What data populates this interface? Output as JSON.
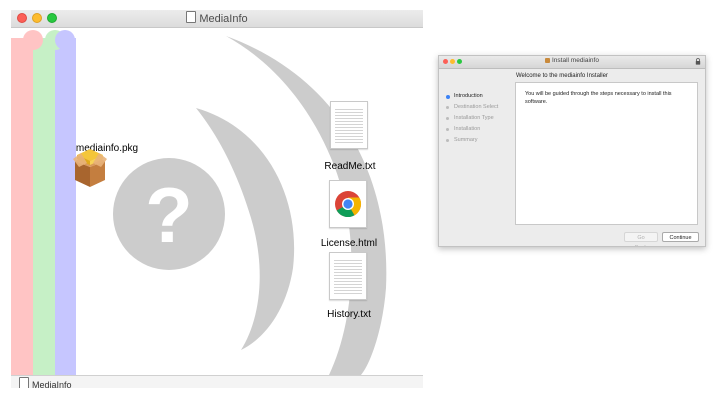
{
  "finder": {
    "title": "MediaInfo",
    "statusbar_label": "MediaInfo",
    "files": {
      "pkg": "mediainfo.pkg",
      "readme": "ReadMe.txt",
      "license": "License.html",
      "history": "History.txt"
    },
    "question_mark": "?",
    "colors": {
      "stripe_red": "#ffc4c4",
      "stripe_green": "#c6f0c6",
      "stripe_blue": "#c6c6ff",
      "shape_gray": "#cccccc"
    }
  },
  "installer": {
    "title": "Install mediainfo",
    "header": "Welcome to the mediainfo Installer",
    "steps": [
      {
        "label": "Introduction",
        "active": true
      },
      {
        "label": "Destination Select",
        "active": false
      },
      {
        "label": "Installation Type",
        "active": false
      },
      {
        "label": "Installation",
        "active": false
      },
      {
        "label": "Summary",
        "active": false
      }
    ],
    "body": "You will be guided through the steps necessary to install this software.",
    "back_label": "Go Back",
    "continue_label": "Continue"
  }
}
